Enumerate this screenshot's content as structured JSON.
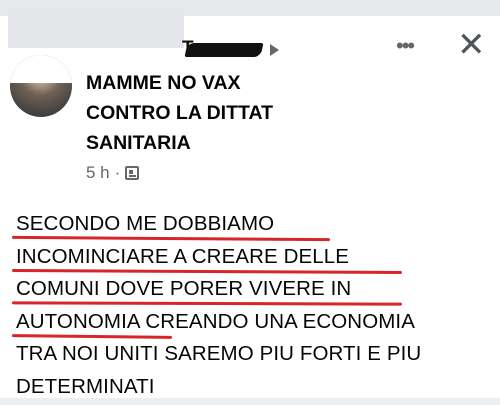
{
  "post": {
    "author_partial": "T",
    "group_name": "MAMME NO VAX\nCONTRO LA DITTAT\nSANITARIA",
    "time": "5 h",
    "separator": "·",
    "privacy_icon": "group-privacy-icon",
    "more_icon": "•••",
    "close_icon": "✕",
    "text_lines": [
      "SECONDO ME DOBBIAMO",
      "INCOMINCIARE A CREARE DELLE",
      "COMUNI DOVE PORER VIVERE IN",
      "AUTONOMIA CREANDO UNA ECONOMIA",
      "TRA NOI UNITI SAREMO PIU FORTI E PIU",
      "DETERMINATI"
    ],
    "underline_color": "#d7262a"
  }
}
